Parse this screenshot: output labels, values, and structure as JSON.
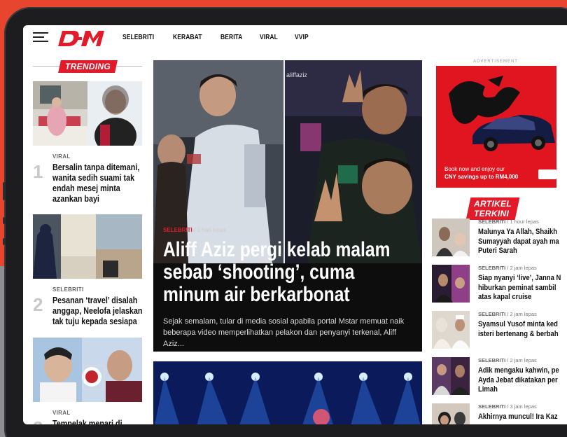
{
  "colors": {
    "brand_red": "#e21b2b",
    "backdrop": "#e8452f",
    "bezel": "#1d1d1f"
  },
  "header": {
    "menu_icon": "hamburger-icon",
    "logo_text": "DM",
    "nav": [
      "SELEBRITI",
      "KERABAT",
      "BERITA",
      "VIRAL",
      "VVIP"
    ]
  },
  "trending": {
    "label": "TRENDING",
    "items": [
      {
        "rank": "1",
        "category": "VIRAL",
        "title_lines": [
          "Bersalin tanpa ditemani,",
          "wanita sedih suami tak",
          "endah mesej minta",
          "azankan bayi"
        ]
      },
      {
        "rank": "2",
        "category": "SELEBRITI",
        "title_lines": [
          "Pesanan ‘travel’ disalah",
          "anggap, Neelofa jelaskan",
          "tak tuju kepada sesiapa"
        ]
      },
      {
        "rank": "3",
        "category": "VIRAL",
        "title_lines": [
          "Tempelak menari di"
        ]
      }
    ]
  },
  "feature": {
    "category": "SELEBRITI",
    "time": "1 hari lepas",
    "photo_caption": "aliffaziz",
    "title_lines": [
      "Aliff Aziz pergi kelab malam",
      "sebab ‘shooting’, cuma",
      "minum air berkarbonat"
    ],
    "excerpt": "Sejak semalam, tular di media sosial apabila portal Mstar memuat naik beberapa video memperlihatkan pelakon dan penyanyi terkenal, Aliff Aziz..."
  },
  "ad": {
    "label": "ADVERTISEMENT",
    "copy_lines": [
      "Book now and enjoy our",
      "CNY savings up to RM4,000"
    ]
  },
  "latest": {
    "label": "ARTIKEL TERKINI",
    "items": [
      {
        "category": "SELEBRITI",
        "time": "1 hour lepas",
        "title_lines": [
          "Malunya Ya Allah, Shaikh",
          "Sumayyah dapat ayah ma",
          "Puteri Sarah"
        ]
      },
      {
        "category": "SELEBRITI",
        "time": "2 jam lepas",
        "title_lines": [
          "Siap nyanyi ‘live’, Janna N",
          "hiburkan peminat sambil",
          "atas kapal cruise"
        ]
      },
      {
        "category": "SELEBRITI",
        "time": "2 jam lepas",
        "title_lines": [
          "Syamsul Yusof minta ked",
          "isteri bertenang & berbah"
        ]
      },
      {
        "category": "SELEBRITI",
        "time": "2 jam lepas",
        "title_lines": [
          "Adik mengaku kahwin, pe",
          "Ayda Jebat dikatakan per",
          "Limah"
        ]
      },
      {
        "category": "SELEBRITI",
        "time": "3 jam lepas",
        "title_lines": [
          "Akhirnya muncul! Ira Kaz"
        ]
      }
    ]
  }
}
